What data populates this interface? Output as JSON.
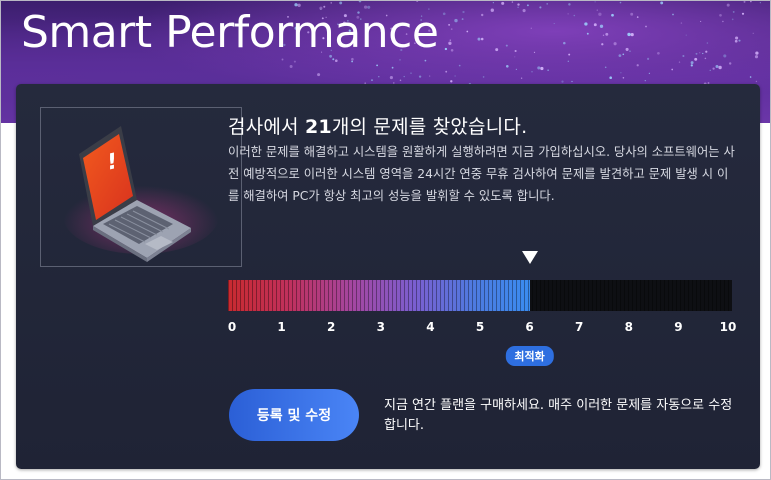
{
  "header": {
    "app_title": "Smart Performance"
  },
  "scan_result": {
    "headline_before": "검사에서 ",
    "issue_count": "21",
    "headline_after": "개의 문제를 찾았습니다.",
    "description": "이러한 문제를 해결하고 시스템을 원활하게 실행하려면 지금 가입하십시오. 당사의 소프트웨어는 사전 예방적으로 이러한 시스템 영역을 24시간 연중 무휴 검사하여 문제를 발견하고 문제 발생 시 이를 해결하여 PC가 항상 최고의 성능을 발휘할 수 있도록 합니다."
  },
  "meter": {
    "scale": [
      "0",
      "1",
      "2",
      "3",
      "4",
      "5",
      "6",
      "7",
      "8",
      "9",
      "10"
    ],
    "value": 6,
    "max": 10,
    "badge_label": "최적화",
    "colors": {
      "low": "#c92a30",
      "mid": "#a347a3",
      "high": "#3a8cf0",
      "empty": "#0e0f13"
    }
  },
  "cta": {
    "button_label": "등록 및 수정",
    "note": "지금 연간 플랜을 구매하세요. 매주 이러한 문제를 자동으로 수정합니다."
  },
  "illustration": {
    "icon": "laptop-warning-icon",
    "accent": "#e3431f"
  }
}
